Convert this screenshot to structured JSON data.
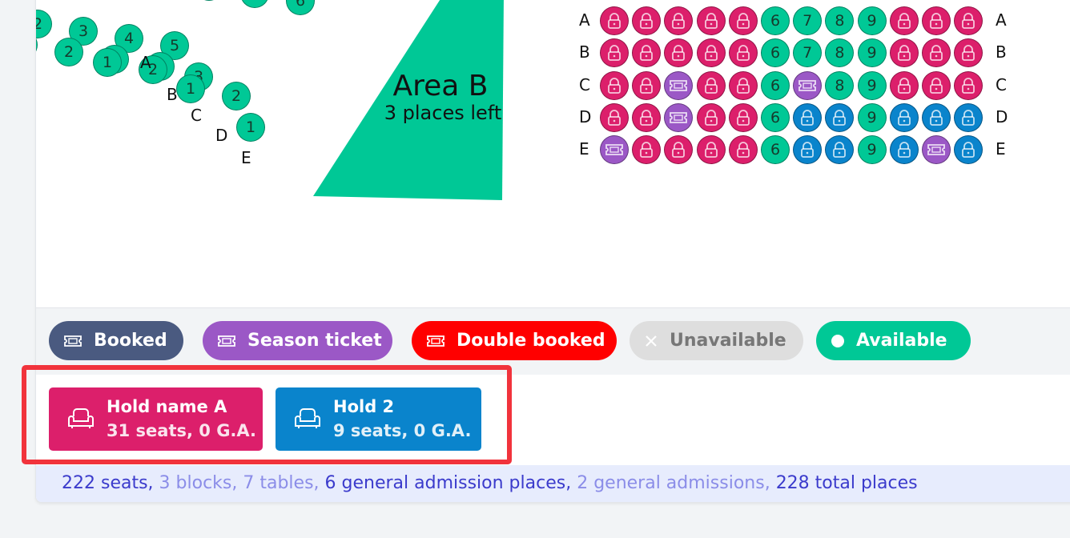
{
  "colors": {
    "available": "#00c896",
    "hold_a": "#dc1f6b",
    "hold_2": "#0a84cc",
    "season": "#9b58c6",
    "booked": "#4a5a80",
    "double_booked": "#ff0000",
    "unavailable": "#dedede",
    "highlight": "#f1333c"
  },
  "area_b": {
    "name": "Area B",
    "places_left": "3 places left"
  },
  "left_block": {
    "row_labels": [
      "A",
      "B",
      "C",
      "D",
      "E"
    ],
    "rows": [
      [
        "6",
        "5",
        "4",
        "3",
        "2"
      ],
      [
        "5",
        "4",
        "3",
        "2",
        "1"
      ],
      [
        "4",
        "3",
        "2",
        "1"
      ],
      [
        "3",
        "2",
        "1"
      ],
      [
        "2",
        "1"
      ],
      [
        "1"
      ]
    ]
  },
  "right_grid": {
    "row_labels": [
      "A",
      "B",
      "C",
      "D",
      "E"
    ],
    "rows": [
      [
        "lock-pink",
        "lock-pink",
        "lock-pink",
        "lock-pink",
        "lock-pink",
        "6",
        "7",
        "8",
        "9",
        "lock-pink",
        "lock-pink",
        "lock-pink"
      ],
      [
        "lock-pink",
        "lock-pink",
        "lock-pink",
        "lock-pink",
        "lock-pink",
        "6",
        "7",
        "8",
        "9",
        "lock-pink",
        "lock-pink",
        "lock-pink"
      ],
      [
        "lock-pink",
        "lock-pink",
        "ticket-purple",
        "lock-pink",
        "lock-pink",
        "6",
        "ticket-purple",
        "8",
        "9",
        "lock-pink",
        "lock-pink",
        "lock-pink"
      ],
      [
        "lock-pink",
        "lock-pink",
        "ticket-purple",
        "lock-pink",
        "lock-pink",
        "6",
        "lock-blue",
        "lock-blue",
        "9",
        "lock-blue",
        "lock-blue",
        "lock-blue"
      ],
      [
        "ticket-purple",
        "lock-pink",
        "lock-pink",
        "lock-pink",
        "lock-pink",
        "6",
        "lock-blue",
        "lock-blue",
        "9",
        "lock-blue",
        "ticket-purple",
        "lock-blue"
      ]
    ]
  },
  "legend": [
    {
      "label": "Booked",
      "icon": "ticket-icon",
      "bg": "#4a5a80",
      "fg": "#ffffff"
    },
    {
      "label": "Season ticket",
      "icon": "ticket-icon",
      "bg": "#9b58c6",
      "fg": "#ffffff"
    },
    {
      "label": "Double booked",
      "icon": "ticket-icon",
      "bg": "#ff0000",
      "fg": "#ffffff"
    },
    {
      "label": "Unavailable",
      "icon": "close-icon",
      "bg": "#dedede",
      "fg": "#777777"
    },
    {
      "label": "Available",
      "icon": "dot-icon",
      "bg": "#00c896",
      "fg": "#ffffff"
    }
  ],
  "holds": [
    {
      "title": "Hold name A",
      "subtitle": "31 seats, 0 G.A.",
      "icon": "armchair-icon",
      "bg": "#dc1f6b"
    },
    {
      "title": "Hold 2",
      "subtitle": "9 seats, 0 G.A.",
      "icon": "armchair-icon",
      "bg": "#0a84cc"
    }
  ],
  "summary": [
    {
      "text": "222 seats,",
      "tone": "dark"
    },
    {
      "text": "3 blocks, 7 tables,",
      "tone": "light"
    },
    {
      "text": "6 general admission places,",
      "tone": "dark"
    },
    {
      "text": "2 general admissions,",
      "tone": "light"
    },
    {
      "text": "228 total places",
      "tone": "dark"
    }
  ]
}
